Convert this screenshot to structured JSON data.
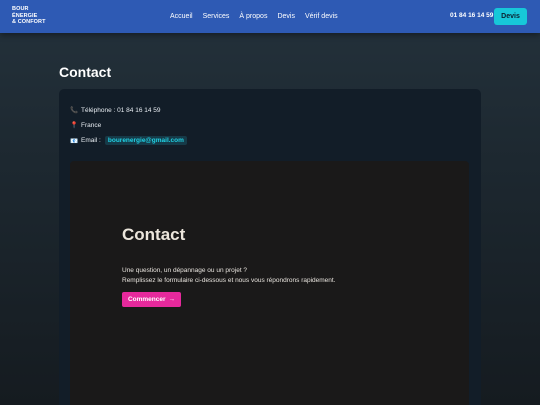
{
  "brand": {
    "line1": "BOUR",
    "line2": "ÉNERGIE",
    "line3": "& CONFORT"
  },
  "nav": {
    "links": [
      "Accueil",
      "Services",
      "À propos",
      "Devis",
      "Vérif devis"
    ],
    "phone": "01 84 16 14 59",
    "cta_label": "Devis"
  },
  "page": {
    "title": "Contact"
  },
  "contact_info": {
    "phone_icon": "📞",
    "phone_text": "Téléphone : 01 84 16 14 59",
    "location_icon": "📍",
    "location_text": "France",
    "email_icon": "📧",
    "email_label": "Email :",
    "email_value": "bourenergie@gmail.com"
  },
  "hero": {
    "title": "Contact",
    "line1": "Une question, un dépannage ou un projet ?",
    "line2": "Remplissez le formulaire ci-dessous et nous vous répondrons rapidement.",
    "button_label": "Commencer",
    "button_arrow": "→"
  },
  "colors": {
    "navbar": "#2e5ab4",
    "accent_cyan": "#17c7d9",
    "accent_pink": "#e6299c"
  }
}
